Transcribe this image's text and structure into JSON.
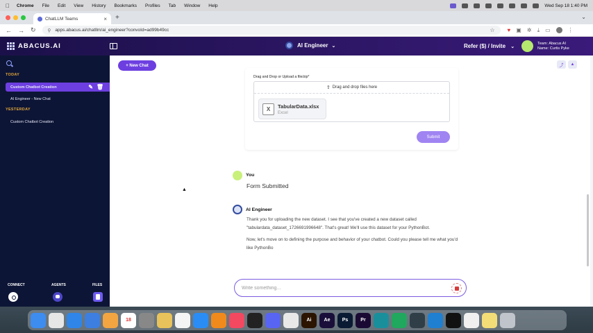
{
  "menubar": {
    "apple": "",
    "items": [
      "Chrome",
      "File",
      "Edit",
      "View",
      "History",
      "Bookmarks",
      "Profiles",
      "Tab",
      "Window",
      "Help"
    ],
    "datetime": "Wed Sep 18  1:40 PM"
  },
  "browser": {
    "tab_title": "ChatLLM Teams",
    "url": "apps.abacus.ai/chatllm/ai_engineer?convoId=ad99b49cc"
  },
  "app": {
    "logo_text": "ABACUS.AI",
    "agent_name": "AI Engineer",
    "refer_label": "Refer ($) / Invite",
    "team_line": "Team: Abacus AI",
    "name_line": "Name: Curtis Pyke"
  },
  "sidebar": {
    "today_label": "TODAY",
    "yesterday_label": "YESTERDAY",
    "today_items": [
      "Custom Chatbot Creation",
      "AI Engineer - New Chat"
    ],
    "yesterday_items": [
      "Custom Chatbot Creation"
    ],
    "bottom": {
      "connect": "CONNECT",
      "agents": "AGENTS",
      "files": "FILES"
    }
  },
  "main": {
    "new_chat_label": "+ New Chat",
    "upload": {
      "label": "Drag and Drop or Upload a file/zip*",
      "dropzone_text": "Drag and drop files here",
      "file_name": "TabularData.xlsx",
      "file_type": "Excel",
      "file_icon_letter": "X",
      "submit_label": "Submit"
    },
    "user_message": {
      "author": "You",
      "text": "Form Submitted"
    },
    "ai_message": {
      "author": "AI Engineer",
      "paragraph1": "Thank you for uploading the new dataset. I see that you've created a new dataset called \"tabulardata_dataset_1726691996648\". That's great! We'll use this dataset for your PythonBot.",
      "paragraph2": "Now, let's move on to defining the purpose and behavior of your chatbot. Could you please tell me what you'd like PythonBo"
    },
    "composer_placeholder": "Write something..."
  },
  "dock": {
    "apps": [
      {
        "name": "finder",
        "color": "#3d8cf0",
        "label": ""
      },
      {
        "name": "launchpad",
        "color": "#e6e6e6",
        "label": ""
      },
      {
        "name": "safari",
        "color": "#2f86e8",
        "label": ""
      },
      {
        "name": "mail",
        "color": "#3d7fe0",
        "label": ""
      },
      {
        "name": "photos",
        "color": "#f2a541",
        "label": ""
      },
      {
        "name": "calendar",
        "color": "#ffffff",
        "label": "18"
      },
      {
        "name": "system-settings",
        "color": "#888888",
        "label": ""
      },
      {
        "name": "notes",
        "color": "#e8c25a",
        "label": ""
      },
      {
        "name": "reminders",
        "color": "#f4f4f4",
        "label": ""
      },
      {
        "name": "app-store",
        "color": "#2a8df5",
        "label": ""
      },
      {
        "name": "vlc",
        "color": "#f08a1c",
        "label": ""
      },
      {
        "name": "music",
        "color": "#f24860",
        "label": ""
      },
      {
        "name": "chatgpt",
        "color": "#222222",
        "label": ""
      },
      {
        "name": "discord",
        "color": "#5865f2",
        "label": ""
      },
      {
        "name": "chrome",
        "color": "#e8e8e8",
        "label": ""
      },
      {
        "name": "illustrator",
        "color": "#2b1400",
        "label": "Ai"
      },
      {
        "name": "after-effects",
        "color": "#1a0f3a",
        "label": "Ae"
      },
      {
        "name": "photoshop",
        "color": "#0a1a33",
        "label": "Ps"
      },
      {
        "name": "premiere",
        "color": "#1a0a33",
        "label": "Pr"
      },
      {
        "name": "edge",
        "color": "#1a8f9c",
        "label": ""
      },
      {
        "name": "messages-app",
        "color": "#1fa85e",
        "label": ""
      },
      {
        "name": "circle-app",
        "color": "#2f3e47",
        "label": ""
      },
      {
        "name": "vscode",
        "color": "#1f7fd1",
        "label": ""
      },
      {
        "name": "capcut",
        "color": "#111111",
        "label": ""
      },
      {
        "name": "textedit",
        "color": "#f0f0f0",
        "label": ""
      },
      {
        "name": "notes-yellow",
        "color": "#f3dd77",
        "label": ""
      },
      {
        "name": "trash",
        "color": "#bfc5ca",
        "label": ""
      }
    ]
  }
}
